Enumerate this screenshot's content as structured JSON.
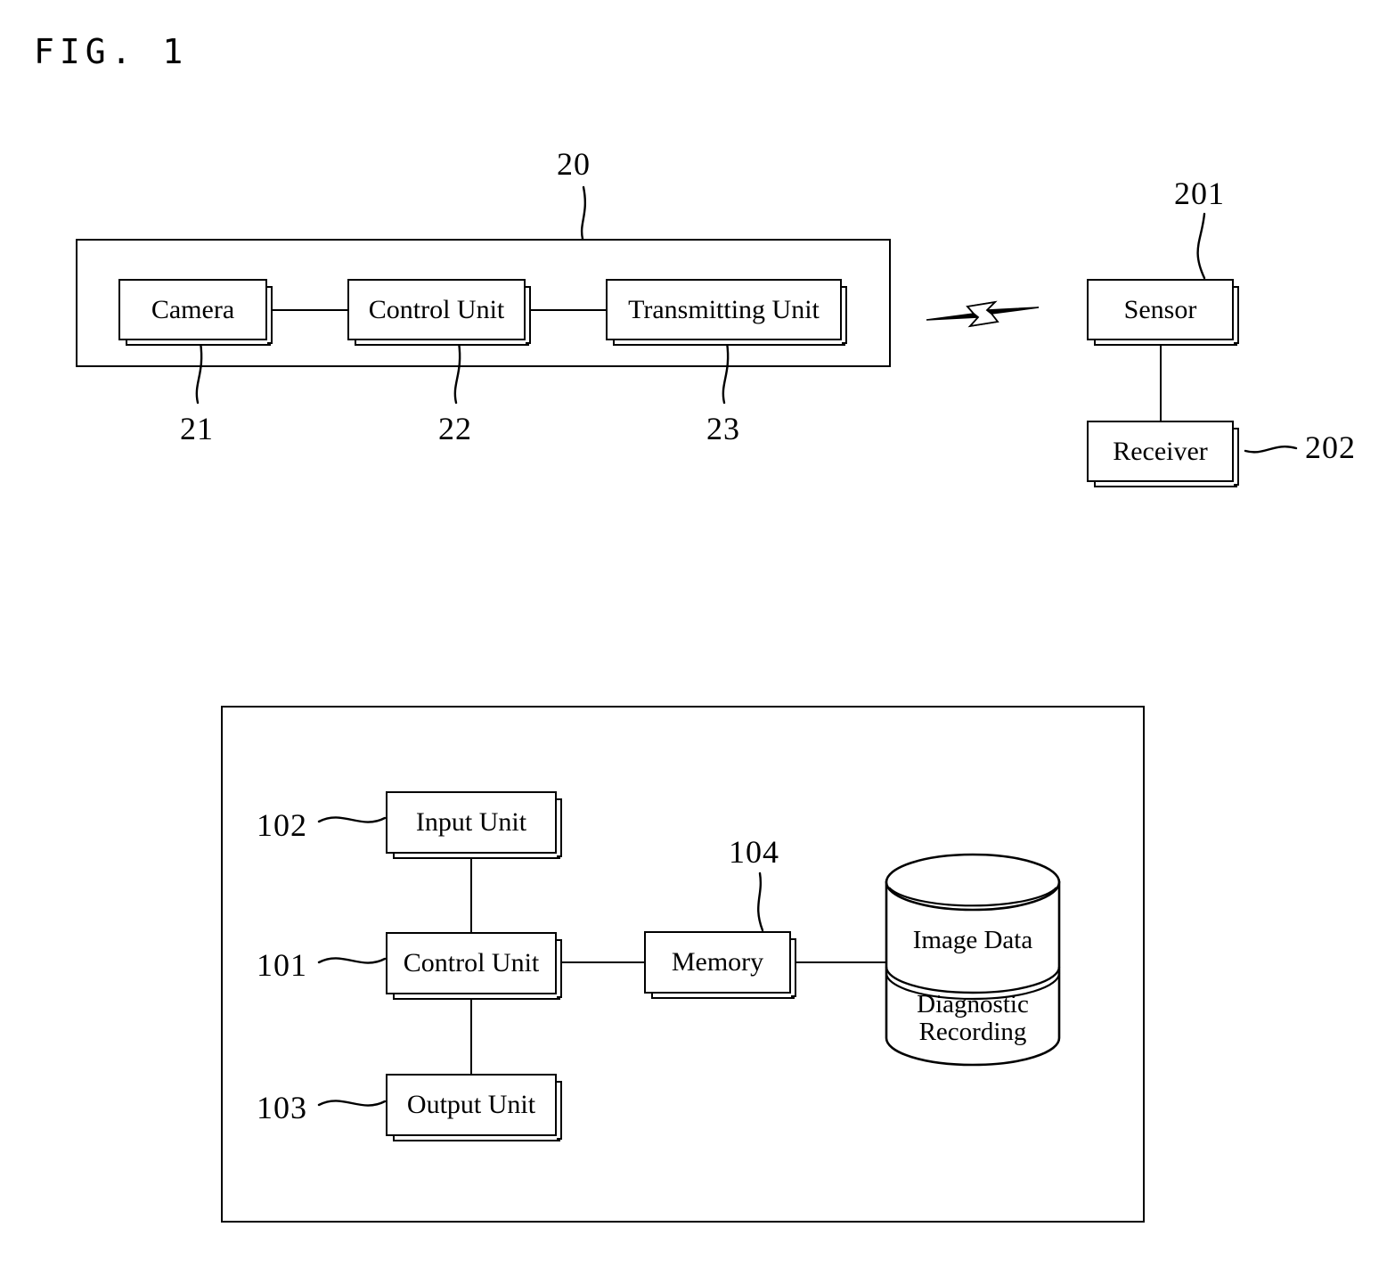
{
  "figure": {
    "title": "FIG. 1"
  },
  "top_diagram": {
    "container_ref": "20",
    "units": [
      {
        "label": "Camera",
        "ref": "21"
      },
      {
        "label": "Control Unit",
        "ref": "22"
      },
      {
        "label": "Transmitting Unit",
        "ref": "23"
      }
    ],
    "wireless_link_icon": "lightning-bolt-icon",
    "remote_units": [
      {
        "label": "Sensor",
        "ref": "201"
      },
      {
        "label": "Receiver",
        "ref": "202"
      }
    ]
  },
  "bottom_diagram": {
    "units": [
      {
        "label": "Input Unit",
        "ref": "102"
      },
      {
        "label": "Control Unit",
        "ref": "101"
      },
      {
        "label": "Output Unit",
        "ref": "103"
      },
      {
        "label": "Memory",
        "ref": "104"
      }
    ],
    "database": {
      "icon": "database-cylinder-icon",
      "top_label": "Image Data",
      "bottom_label_line1": "Diagnostic",
      "bottom_label_line2": "Recording"
    }
  },
  "colors": {
    "ink": "#000000",
    "paper": "#ffffff"
  }
}
